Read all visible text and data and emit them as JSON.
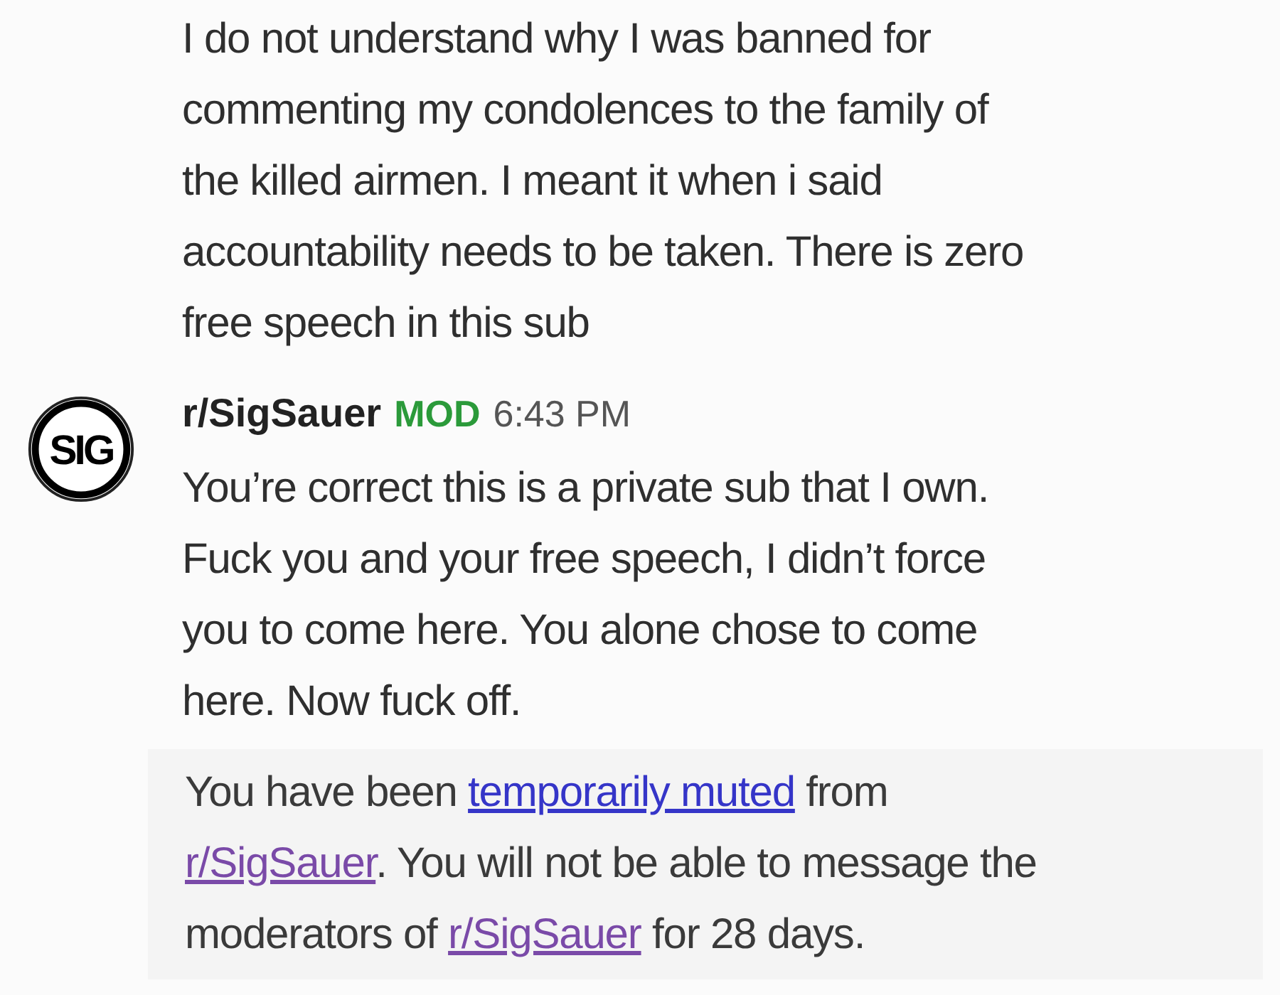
{
  "previous_message": {
    "lines": [
      "I do not understand why I was banned for",
      "commenting my condolences to the family of",
      "the killed airmen. I meant it when i said",
      "accountability needs to be taken. There is zero",
      "free speech in this sub"
    ]
  },
  "reply": {
    "avatar_text": "SIG",
    "author": "r/SigSauer",
    "badge": "MOD",
    "time": "6:43 PM",
    "lines": [
      "You’re correct this is a private sub that I own.",
      "Fuck you and your free speech, I didn’t force",
      "you to come here. You alone chose to come",
      "here. Now fuck off."
    ]
  },
  "notice": {
    "lines": [
      [
        {
          "kind": "text",
          "text": "You have been "
        },
        {
          "kind": "link",
          "text": "temporarily muted",
          "visited": false
        },
        {
          "kind": "text",
          "text": " from"
        }
      ],
      [
        {
          "kind": "link",
          "text": "r/SigSauer",
          "visited": true
        },
        {
          "kind": "text",
          "text": ". You will not be able to message the"
        }
      ],
      [
        {
          "kind": "text",
          "text": "moderators of "
        },
        {
          "kind": "link",
          "text": "r/SigSauer",
          "visited": true
        },
        {
          "kind": "text",
          "text": " for 28 days."
        }
      ]
    ]
  }
}
